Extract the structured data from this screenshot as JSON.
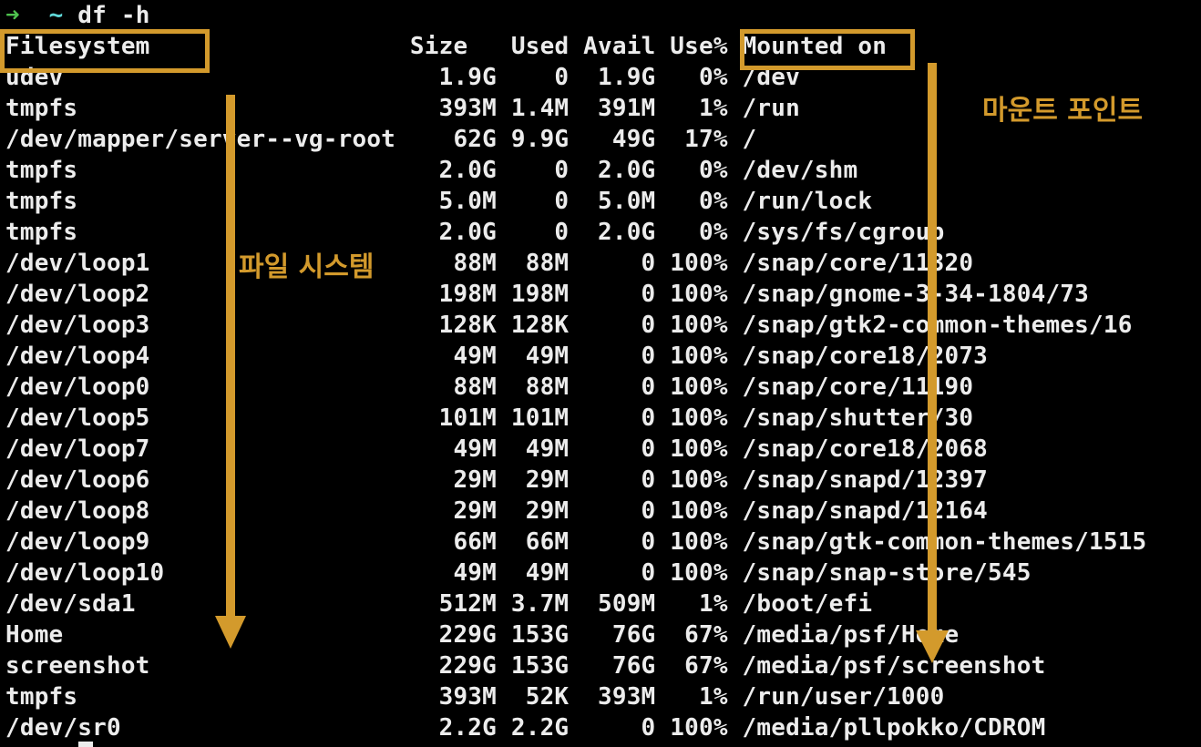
{
  "terminal": {
    "prompt_arrow": "➜",
    "prompt_dir": "~",
    "command": "df -h",
    "header": [
      "Filesystem",
      "Size",
      "Used",
      "Avail",
      "Use%",
      "Mounted on"
    ],
    "rows": [
      [
        "udev",
        "1.9G",
        "0",
        "1.9G",
        "0%",
        "/dev"
      ],
      [
        "tmpfs",
        "393M",
        "1.4M",
        "391M",
        "1%",
        "/run"
      ],
      [
        "/dev/mapper/server--vg-root",
        "62G",
        "9.9G",
        "49G",
        "17%",
        "/"
      ],
      [
        "tmpfs",
        "2.0G",
        "0",
        "2.0G",
        "0%",
        "/dev/shm"
      ],
      [
        "tmpfs",
        "5.0M",
        "0",
        "5.0M",
        "0%",
        "/run/lock"
      ],
      [
        "tmpfs",
        "2.0G",
        "0",
        "2.0G",
        "0%",
        "/sys/fs/cgroup"
      ],
      [
        "/dev/loop1",
        "88M",
        "88M",
        "0",
        "100%",
        "/snap/core/11320"
      ],
      [
        "/dev/loop2",
        "198M",
        "198M",
        "0",
        "100%",
        "/snap/gnome-3-34-1804/73"
      ],
      [
        "/dev/loop3",
        "128K",
        "128K",
        "0",
        "100%",
        "/snap/gtk2-common-themes/16"
      ],
      [
        "/dev/loop4",
        "49M",
        "49M",
        "0",
        "100%",
        "/snap/core18/2073"
      ],
      [
        "/dev/loop0",
        "88M",
        "88M",
        "0",
        "100%",
        "/snap/core/11190"
      ],
      [
        "/dev/loop5",
        "101M",
        "101M",
        "0",
        "100%",
        "/snap/shutter/30"
      ],
      [
        "/dev/loop7",
        "49M",
        "49M",
        "0",
        "100%",
        "/snap/core18/2068"
      ],
      [
        "/dev/loop6",
        "29M",
        "29M",
        "0",
        "100%",
        "/snap/snapd/12397"
      ],
      [
        "/dev/loop8",
        "29M",
        "29M",
        "0",
        "100%",
        "/snap/snapd/12164"
      ],
      [
        "/dev/loop9",
        "66M",
        "66M",
        "0",
        "100%",
        "/snap/gtk-common-themes/1515"
      ],
      [
        "/dev/loop10",
        "49M",
        "49M",
        "0",
        "100%",
        "/snap/snap-store/545"
      ],
      [
        "/dev/sda1",
        "512M",
        "3.7M",
        "509M",
        "1%",
        "/boot/efi"
      ],
      [
        "Home",
        "229G",
        "153G",
        "76G",
        "67%",
        "/media/psf/Home"
      ],
      [
        "screenshot",
        "229G",
        "153G",
        "76G",
        "67%",
        "/media/psf/screenshot"
      ],
      [
        "tmpfs",
        "393M",
        "52K",
        "393M",
        "1%",
        "/run/user/1000"
      ],
      [
        "/dev/sr0",
        "2.2G",
        "2.2G",
        "0",
        "100%",
        "/media/pllpokko/CDROM"
      ]
    ]
  },
  "annotations": {
    "filesystem_label": "파일 시스템",
    "mount_point_label": "마운트 포인트",
    "highlight_color": "#d39a2c"
  },
  "colors": {
    "background": "#000000",
    "text": "#ececec",
    "prompt_arrow": "#4ec24e",
    "prompt_dir": "#5fd7d7"
  }
}
